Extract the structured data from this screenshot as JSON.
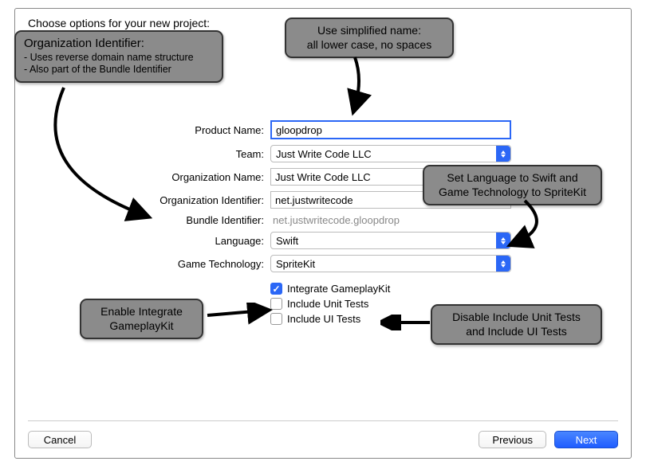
{
  "dialog": {
    "header": "Choose options for your new project:"
  },
  "form": {
    "productName": {
      "label": "Product Name:",
      "value": "gloopdrop"
    },
    "team": {
      "label": "Team:",
      "value": "Just Write Code LLC"
    },
    "orgName": {
      "label": "Organization Name:",
      "value": "Just Write Code LLC"
    },
    "orgId": {
      "label": "Organization Identifier:",
      "value": "net.justwritecode"
    },
    "bundleId": {
      "label": "Bundle Identifier:",
      "value": "net.justwritecode.gloopdrop"
    },
    "language": {
      "label": "Language:",
      "value": "Swift"
    },
    "gameTech": {
      "label": "Game Technology:",
      "value": "SpriteKit"
    },
    "integrateGameplayKit": {
      "label": "Integrate GameplayKit"
    },
    "includeUnitTests": {
      "label": "Include Unit Tests"
    },
    "includeUITests": {
      "label": "Include UI Tests"
    }
  },
  "buttons": {
    "cancel": "Cancel",
    "previous": "Previous",
    "next": "Next"
  },
  "annotations": {
    "orgIdTitle": "Organization Identifier:",
    "orgIdBullet1": "- Uses reverse domain name structure",
    "orgIdBullet2": "- Also part of the Bundle Identifier",
    "simplifiedName": "Use simplified name:\nall lower case, no spaces",
    "langTech": "Set Language to Swift and\nGame Technology to SpriteKit",
    "enableGameplayKit": "Enable Integrate\nGameplayKit",
    "disableTests": "Disable Include Unit Tests\nand Include UI Tests"
  }
}
